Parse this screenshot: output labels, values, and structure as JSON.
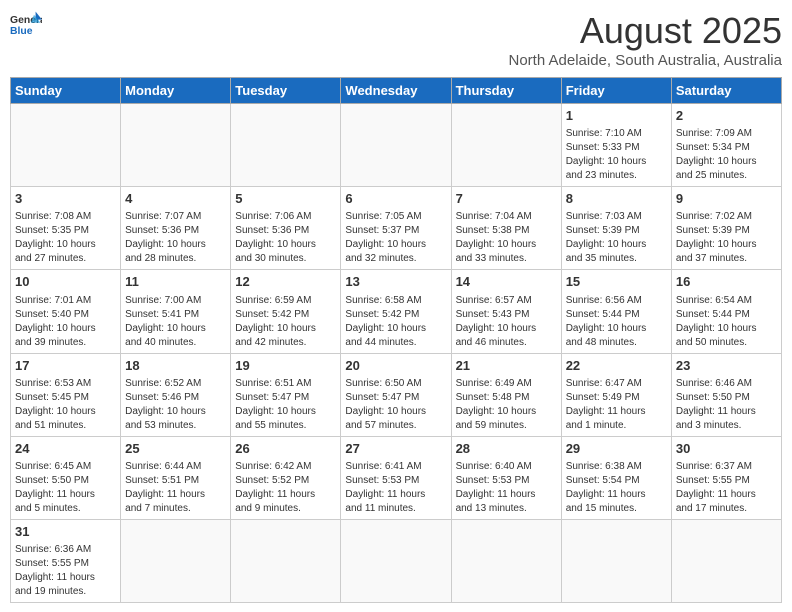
{
  "logo": {
    "text_general": "General",
    "text_blue": "Blue"
  },
  "title": {
    "month_year": "August 2025",
    "location": "North Adelaide, South Australia, Australia"
  },
  "weekdays": [
    "Sunday",
    "Monday",
    "Tuesday",
    "Wednesday",
    "Thursday",
    "Friday",
    "Saturday"
  ],
  "weeks": [
    [
      {
        "day": "",
        "info": ""
      },
      {
        "day": "",
        "info": ""
      },
      {
        "day": "",
        "info": ""
      },
      {
        "day": "",
        "info": ""
      },
      {
        "day": "",
        "info": ""
      },
      {
        "day": "1",
        "info": "Sunrise: 7:10 AM\nSunset: 5:33 PM\nDaylight: 10 hours\nand 23 minutes."
      },
      {
        "day": "2",
        "info": "Sunrise: 7:09 AM\nSunset: 5:34 PM\nDaylight: 10 hours\nand 25 minutes."
      }
    ],
    [
      {
        "day": "3",
        "info": "Sunrise: 7:08 AM\nSunset: 5:35 PM\nDaylight: 10 hours\nand 27 minutes."
      },
      {
        "day": "4",
        "info": "Sunrise: 7:07 AM\nSunset: 5:36 PM\nDaylight: 10 hours\nand 28 minutes."
      },
      {
        "day": "5",
        "info": "Sunrise: 7:06 AM\nSunset: 5:36 PM\nDaylight: 10 hours\nand 30 minutes."
      },
      {
        "day": "6",
        "info": "Sunrise: 7:05 AM\nSunset: 5:37 PM\nDaylight: 10 hours\nand 32 minutes."
      },
      {
        "day": "7",
        "info": "Sunrise: 7:04 AM\nSunset: 5:38 PM\nDaylight: 10 hours\nand 33 minutes."
      },
      {
        "day": "8",
        "info": "Sunrise: 7:03 AM\nSunset: 5:39 PM\nDaylight: 10 hours\nand 35 minutes."
      },
      {
        "day": "9",
        "info": "Sunrise: 7:02 AM\nSunset: 5:39 PM\nDaylight: 10 hours\nand 37 minutes."
      }
    ],
    [
      {
        "day": "10",
        "info": "Sunrise: 7:01 AM\nSunset: 5:40 PM\nDaylight: 10 hours\nand 39 minutes."
      },
      {
        "day": "11",
        "info": "Sunrise: 7:00 AM\nSunset: 5:41 PM\nDaylight: 10 hours\nand 40 minutes."
      },
      {
        "day": "12",
        "info": "Sunrise: 6:59 AM\nSunset: 5:42 PM\nDaylight: 10 hours\nand 42 minutes."
      },
      {
        "day": "13",
        "info": "Sunrise: 6:58 AM\nSunset: 5:42 PM\nDaylight: 10 hours\nand 44 minutes."
      },
      {
        "day": "14",
        "info": "Sunrise: 6:57 AM\nSunset: 5:43 PM\nDaylight: 10 hours\nand 46 minutes."
      },
      {
        "day": "15",
        "info": "Sunrise: 6:56 AM\nSunset: 5:44 PM\nDaylight: 10 hours\nand 48 minutes."
      },
      {
        "day": "16",
        "info": "Sunrise: 6:54 AM\nSunset: 5:44 PM\nDaylight: 10 hours\nand 50 minutes."
      }
    ],
    [
      {
        "day": "17",
        "info": "Sunrise: 6:53 AM\nSunset: 5:45 PM\nDaylight: 10 hours\nand 51 minutes."
      },
      {
        "day": "18",
        "info": "Sunrise: 6:52 AM\nSunset: 5:46 PM\nDaylight: 10 hours\nand 53 minutes."
      },
      {
        "day": "19",
        "info": "Sunrise: 6:51 AM\nSunset: 5:47 PM\nDaylight: 10 hours\nand 55 minutes."
      },
      {
        "day": "20",
        "info": "Sunrise: 6:50 AM\nSunset: 5:47 PM\nDaylight: 10 hours\nand 57 minutes."
      },
      {
        "day": "21",
        "info": "Sunrise: 6:49 AM\nSunset: 5:48 PM\nDaylight: 10 hours\nand 59 minutes."
      },
      {
        "day": "22",
        "info": "Sunrise: 6:47 AM\nSunset: 5:49 PM\nDaylight: 11 hours\nand 1 minute."
      },
      {
        "day": "23",
        "info": "Sunrise: 6:46 AM\nSunset: 5:50 PM\nDaylight: 11 hours\nand 3 minutes."
      }
    ],
    [
      {
        "day": "24",
        "info": "Sunrise: 6:45 AM\nSunset: 5:50 PM\nDaylight: 11 hours\nand 5 minutes."
      },
      {
        "day": "25",
        "info": "Sunrise: 6:44 AM\nSunset: 5:51 PM\nDaylight: 11 hours\nand 7 minutes."
      },
      {
        "day": "26",
        "info": "Sunrise: 6:42 AM\nSunset: 5:52 PM\nDaylight: 11 hours\nand 9 minutes."
      },
      {
        "day": "27",
        "info": "Sunrise: 6:41 AM\nSunset: 5:53 PM\nDaylight: 11 hours\nand 11 minutes."
      },
      {
        "day": "28",
        "info": "Sunrise: 6:40 AM\nSunset: 5:53 PM\nDaylight: 11 hours\nand 13 minutes."
      },
      {
        "day": "29",
        "info": "Sunrise: 6:38 AM\nSunset: 5:54 PM\nDaylight: 11 hours\nand 15 minutes."
      },
      {
        "day": "30",
        "info": "Sunrise: 6:37 AM\nSunset: 5:55 PM\nDaylight: 11 hours\nand 17 minutes."
      }
    ],
    [
      {
        "day": "31",
        "info": "Sunrise: 6:36 AM\nSunset: 5:55 PM\nDaylight: 11 hours\nand 19 minutes."
      },
      {
        "day": "",
        "info": ""
      },
      {
        "day": "",
        "info": ""
      },
      {
        "day": "",
        "info": ""
      },
      {
        "day": "",
        "info": ""
      },
      {
        "day": "",
        "info": ""
      },
      {
        "day": "",
        "info": ""
      }
    ]
  ]
}
